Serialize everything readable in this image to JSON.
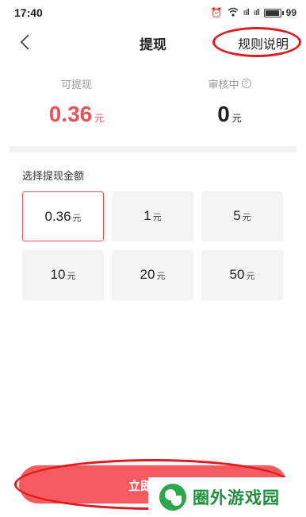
{
  "status_bar": {
    "time": "17:40",
    "signal_1": "ııll",
    "signal_2": "ııll",
    "battery": "99",
    "battery_level": 0.99
  },
  "nav": {
    "title": "提现",
    "rules_label": "规则说明"
  },
  "balances": {
    "available": {
      "label": "可提现",
      "value": "0.36",
      "unit": "元"
    },
    "pending": {
      "label": "审核中",
      "help": "?",
      "value": "0",
      "unit": "元"
    }
  },
  "amount_section": {
    "header": "选择提现金额",
    "options": [
      {
        "value": "0.36",
        "unit": "元",
        "selected": true
      },
      {
        "value": "1",
        "unit": "元"
      },
      {
        "value": "5",
        "unit": "元"
      },
      {
        "value": "10",
        "unit": "元"
      },
      {
        "value": "20",
        "unit": "元"
      },
      {
        "value": "50",
        "unit": "元"
      }
    ]
  },
  "submit": {
    "label": "立即"
  },
  "watermark": {
    "text": "圈外游戏园"
  },
  "colors": {
    "accent": "#e8525a",
    "button": "#f55a5e",
    "annotation": "#e0191f",
    "watermark": "#1f8f3e"
  }
}
